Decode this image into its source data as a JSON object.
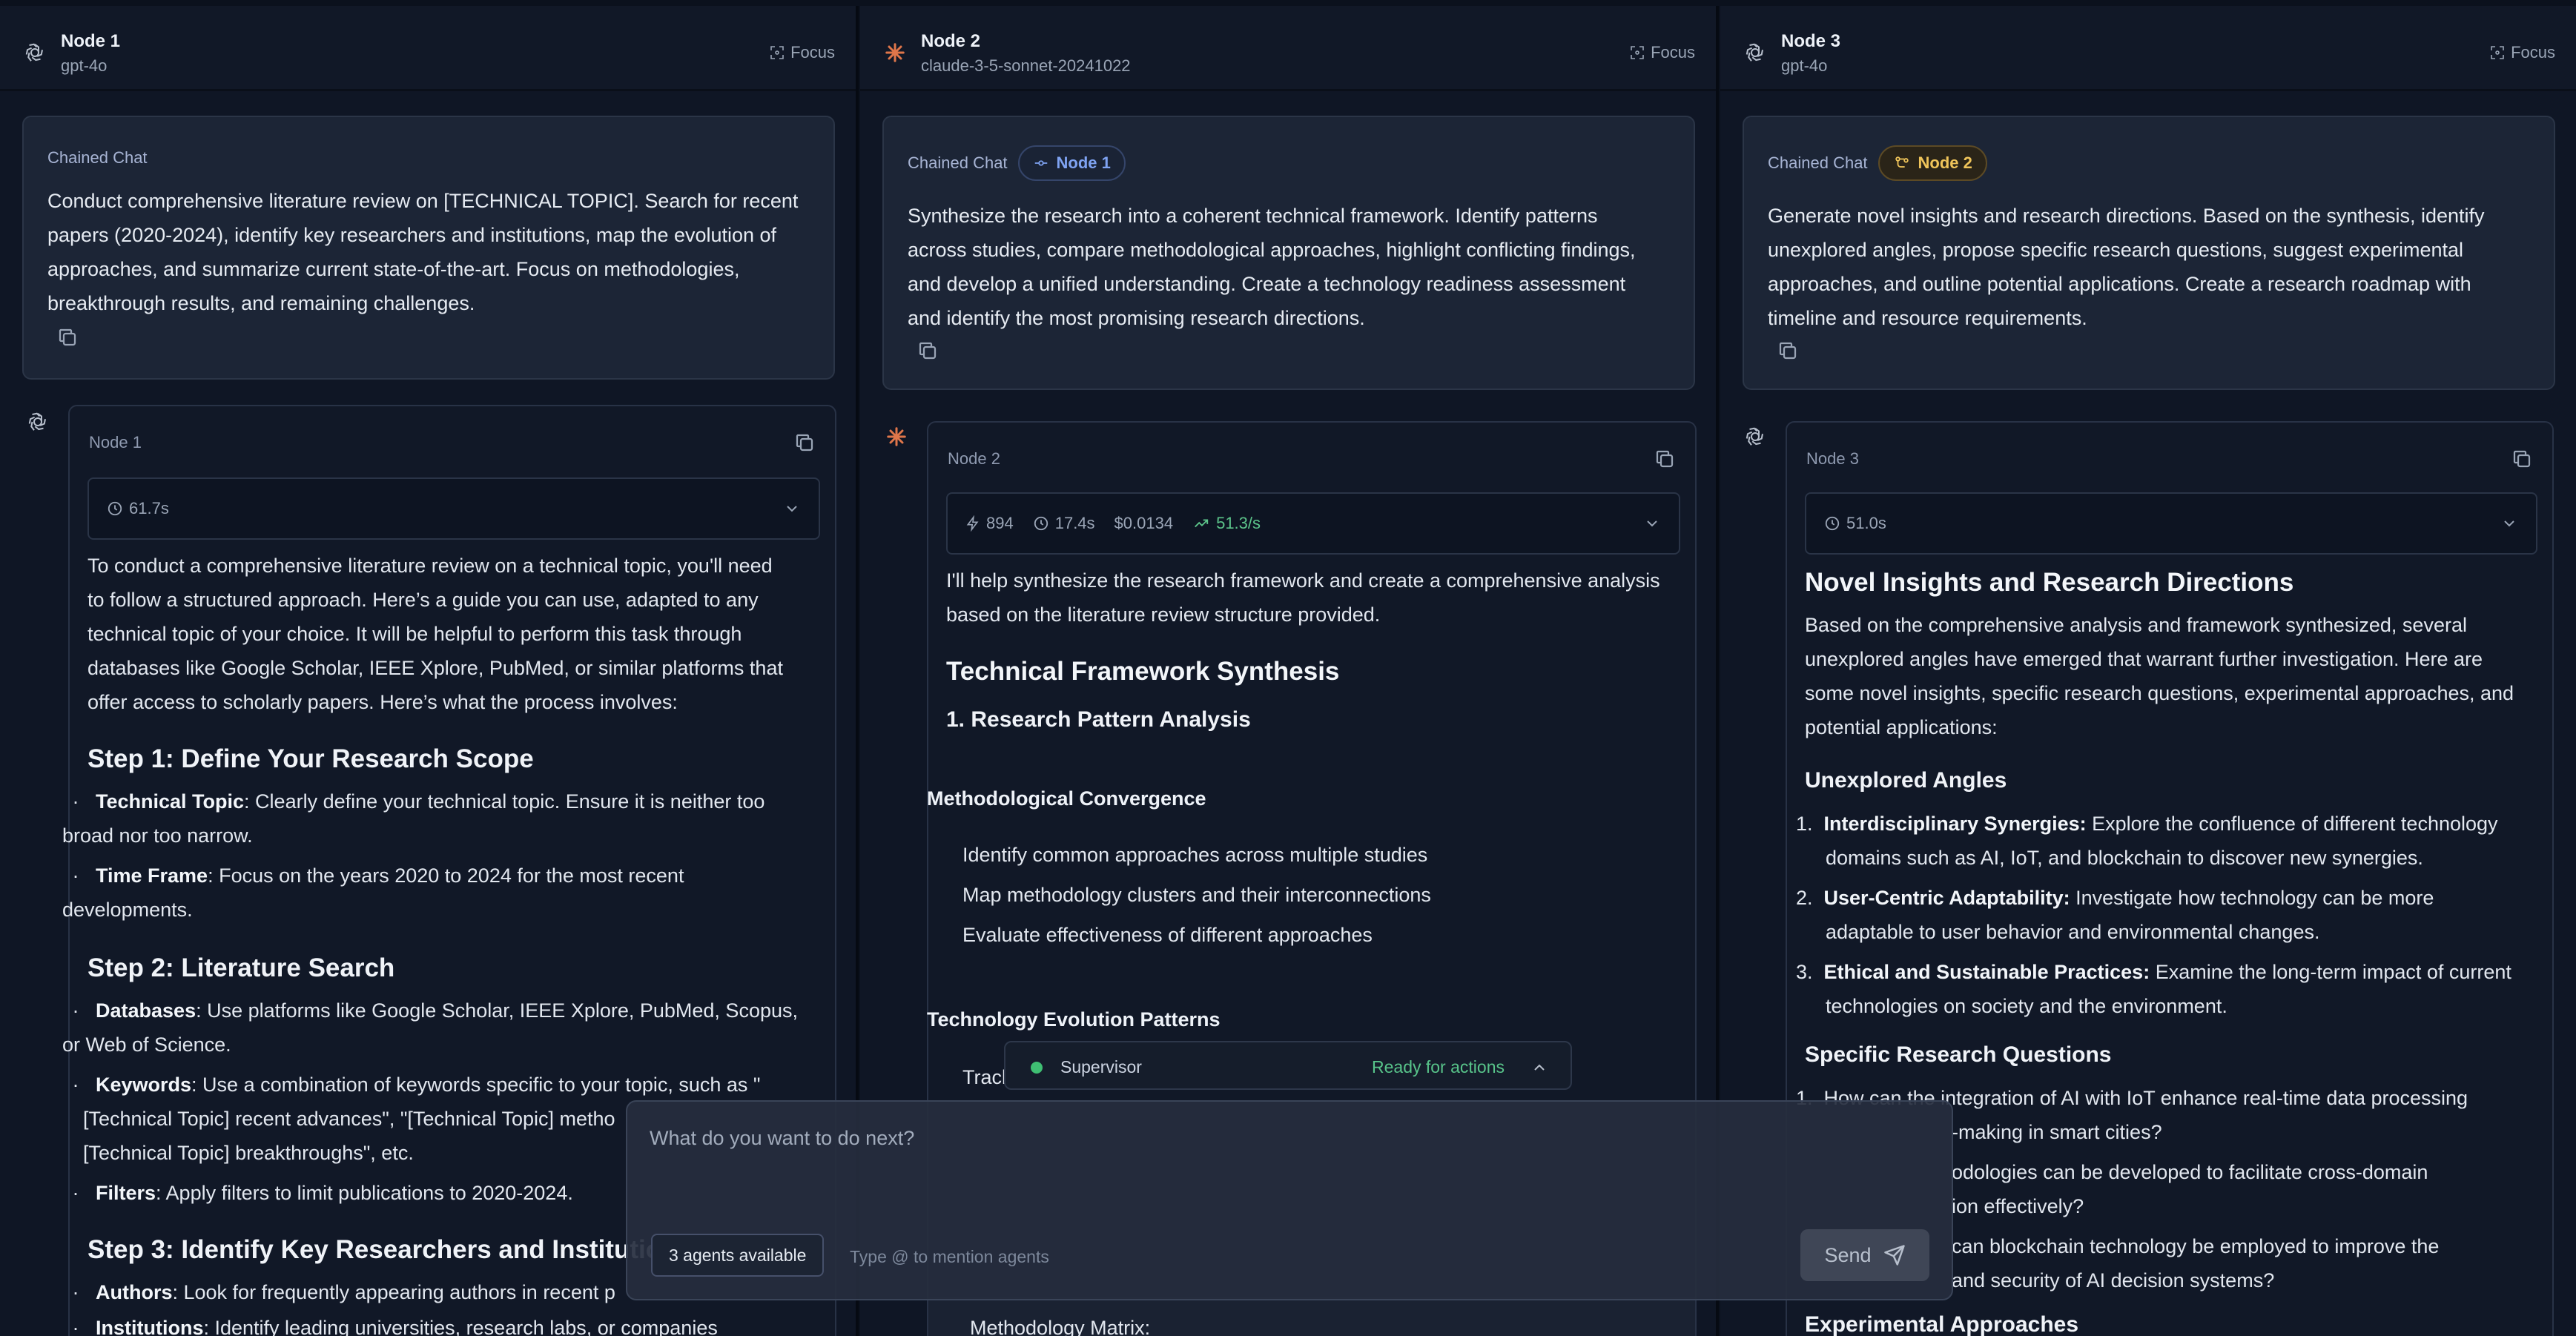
{
  "nodes": [
    {
      "title": "Node 1",
      "model": "gpt-4o",
      "focus_label": "Focus",
      "chained_label": "Chained Chat",
      "prompt_lines": [
        "Conduct comprehensive literature review on [TECHNICAL TOPIC]. Search for recent",
        "papers (2020-2024), identify key researchers and institutions, map the evolution of",
        "approaches, and summarize current state-of-the-art. Focus on methodologies,",
        "breakthrough results, and remaining challenges."
      ],
      "response": {
        "name": "Node 1",
        "time": "61.7s",
        "intro_lines": [
          "To conduct a comprehensive literature review on a technical topic, you'll need",
          "to follow a structured approach. Here’s a guide you can use, adapted to any",
          "technical topic of your choice. It will be helpful to perform this task through",
          "databases like Google Scholar, IEEE Xplore, PubMed, or similar platforms that",
          "offer access to scholarly papers. Here’s what the process involves:"
        ],
        "step1": "Step 1: Define Your Research Scope",
        "s1_a_b": "Technical Topic",
        "s1_a_1": ": Clearly define your technical topic. Ensure it is neither too",
        "s1_a_2": "broad nor too narrow.",
        "s1_b_b": "Time Frame",
        "s1_b_1": ": Focus on the years 2020 to 2024 for the most recent",
        "s1_b_2": "developments.",
        "step2": "Step 2: Literature Search",
        "s2_a_b": "Databases",
        "s2_a_1": ": Use platforms like Google Scholar, IEEE Xplore, PubMed, Scopus,",
        "s2_a_2": "or Web of Science.",
        "s2_b_b": "Keywords",
        "s2_b_1": ": Use a combination of keywords specific to your topic, such as \"",
        "s2_b_2": "[Technical Topic] recent advances\", \"[Technical Topic] metho",
        "s2_b_3": "[Technical Topic] breakthroughs\", etc.",
        "s2_c_b": "Filters",
        "s2_c_1": ": Apply filters to limit publications to 2020-2024.",
        "step3": "Step 3: Identify Key Researchers and Institution",
        "s3_a_b": "Authors",
        "s3_a_1": ": Look for frequently appearing authors in recent p",
        "s3_b_b": "Institutions",
        "s3_b_1": ": Identify leading universities, research labs, or companies"
      }
    },
    {
      "title": "Node 2",
      "model": "claude-3-5-sonnet-20241022",
      "focus_label": "Focus",
      "chained_label": "Chained Chat",
      "chained_pill": "Node 1",
      "prompt_lines": [
        "Synthesize the research into a coherent technical framework. Identify patterns",
        "across studies, compare methodological approaches, highlight conflicting findings,",
        "and develop a unified understanding. Create a technology readiness assessment",
        "and identify the most promising research directions."
      ],
      "response": {
        "name": "Node 2",
        "tokens": "894",
        "time": "17.4s",
        "cost": "$0.0134",
        "rate": "51.3/s",
        "intro_lines": [
          "I'll help synthesize the research framework and create a comprehensive analysis",
          "based on the literature review structure provided."
        ],
        "h2": "Technical Framework Synthesis",
        "h3": "1. Research Pattern Analysis",
        "sub1": "Methodological Convergence",
        "items": [
          "Identify common approaches across multiple studies",
          "Map methodology clusters and their interconnections",
          "Evaluate effectiveness of different approaches"
        ],
        "sub2": "Technology Evolution Patterns",
        "partial": "Tracl",
        "matrix": "Methodology Matrix:"
      }
    },
    {
      "title": "Node 3",
      "model": "gpt-4o",
      "focus_label": "Focus",
      "chained_label": "Chained Chat",
      "chained_pill": "Node 2",
      "prompt_lines": [
        "Generate novel insights and research directions. Based on the synthesis, identify",
        "unexplored angles, propose specific research questions, suggest experimental",
        "approaches, and outline potential applications. Create a research roadmap with",
        "timeline and resource requirements."
      ],
      "response": {
        "name": "Node 3",
        "time": "51.0s",
        "h2": "Novel Insights and Research Directions",
        "intro_lines": [
          "Based on the comprehensive analysis and framework synthesized, several",
          "unexplored angles have emerged that warrant further investigation. Here are",
          "some novel insights, specific research questions, experimental approaches, and",
          "potential applications:"
        ],
        "h3a": "Unexplored Angles",
        "u1_b": "Interdisciplinary Synergies:",
        "u1_1": " Explore the confluence of different technology",
        "u1_2": "domains such as AI, IoT, and blockchain to discover new synergies.",
        "u2_b": "User-Centric Adaptability:",
        "u2_1": " Investigate how technology can be more",
        "u2_2": "adaptable to user behavior and environmental changes.",
        "u3_b": "Ethical and Sustainable Practices:",
        "u3_1": " Examine the long-term impact of current",
        "u3_2": "technologies on society and the environment.",
        "h3b": "Specific Research Questions",
        "q1_1": "How can the integration of AI with IoT enhance real-time data processing",
        "q1_2": "-making in smart cities?",
        "q2_1": "odologies can be developed to facilitate cross-domain",
        "q2_2": "ion effectively?",
        "q3_1": "can blockchain technology be employed to improve the",
        "q3_2": "and security of AI decision systems?",
        "h3c": "Experimental Approaches"
      }
    }
  ],
  "supervisor": {
    "name": "Supervisor",
    "status": "Ready for actions"
  },
  "composer": {
    "placeholder": "What do you want to do next?",
    "agents_label": "3 agents available",
    "mention_hint": "Type @ to mention agents",
    "send_label": "Send"
  },
  "colors": {
    "status_green": "#3fbf73",
    "pill_blue": "#7fa3f2",
    "pill_amber": "#efc45a",
    "claude_orange": "#e0764a"
  },
  "icons": [
    "openai-icon",
    "claude-icon",
    "focus-icon",
    "copy-icon",
    "clock-icon",
    "bolt-icon",
    "dollar-icon",
    "trend-icon",
    "chevron-down-icon",
    "chevron-up-icon",
    "send-icon",
    "link-icon"
  ]
}
